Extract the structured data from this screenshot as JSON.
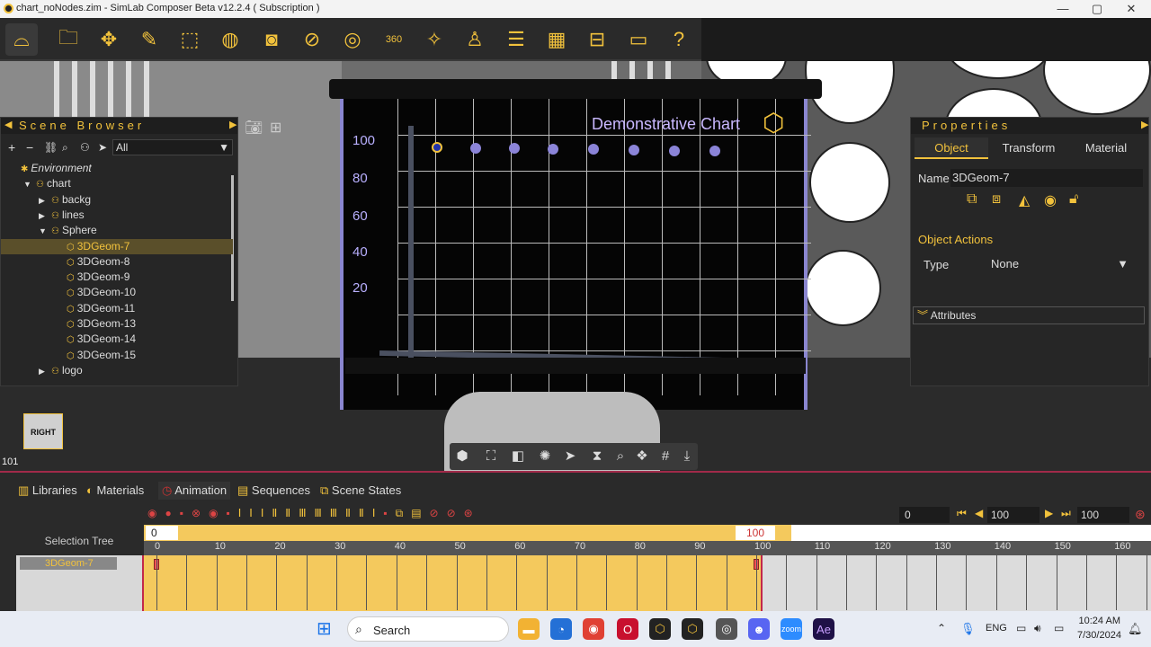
{
  "titlebar": {
    "title": "chart_noNodes.zim - SimLab Composer Beta v12.2.4 ( Subscription )",
    "min": "—",
    "max": "▢",
    "close": "✕"
  },
  "toolbar": {
    "icons": [
      "vr-headset-icon",
      "open-folder-icon",
      "move-icon",
      "edit-icon",
      "select-box-icon",
      "render-icon",
      "camera-icon",
      "material-icon",
      "globe-icon",
      "panorama-360-icon",
      "magic-wand-icon",
      "light-icon",
      "list-icon",
      "grid-icon",
      "vr-view-icon",
      "presentation-icon",
      "help-icon"
    ]
  },
  "chart": {
    "title": "Demonstrative Chart",
    "yticks": [
      "100",
      "80",
      "60",
      "40",
      "20"
    ],
    "chart_data": {
      "type": "scatter",
      "title": "Demonstrative Chart",
      "y": [
        100,
        100,
        100,
        100,
        100,
        100,
        100,
        100
      ],
      "yticks": [
        100,
        80,
        60,
        40,
        20
      ]
    }
  },
  "viewcube": {
    "label": "RIGHT"
  },
  "frame_counter": "101",
  "scene_browser": {
    "title": "Scene Browser",
    "filter": "All",
    "items": [
      {
        "label": "Environment",
        "indent": 0,
        "expander": "",
        "icon": "✱"
      },
      {
        "label": "chart",
        "indent": 1,
        "expander": "▼",
        "icon": "⚇"
      },
      {
        "label": "backg",
        "indent": 2,
        "expander": "▶",
        "icon": "⚇"
      },
      {
        "label": "lines",
        "indent": 2,
        "expander": "▶",
        "icon": "⚇"
      },
      {
        "label": "Sphere",
        "indent": 2,
        "expander": "▼",
        "icon": "⚇"
      },
      {
        "label": "3DGeom-7",
        "indent": 3,
        "expander": "",
        "icon": "⬡"
      },
      {
        "label": "3DGeom-8",
        "indent": 3,
        "expander": "",
        "icon": "⬡"
      },
      {
        "label": "3DGeom-9",
        "indent": 3,
        "expander": "",
        "icon": "⬡"
      },
      {
        "label": "3DGeom-10",
        "indent": 3,
        "expander": "",
        "icon": "⬡"
      },
      {
        "label": "3DGeom-11",
        "indent": 3,
        "expander": "",
        "icon": "⬡"
      },
      {
        "label": "3DGeom-13",
        "indent": 3,
        "expander": "",
        "icon": "⬡"
      },
      {
        "label": "3DGeom-14",
        "indent": 3,
        "expander": "",
        "icon": "⬡"
      },
      {
        "label": "3DGeom-15",
        "indent": 3,
        "expander": "",
        "icon": "⬡"
      },
      {
        "label": "logo",
        "indent": 2,
        "expander": "▶",
        "icon": "⚇"
      }
    ]
  },
  "properties": {
    "title": "Properties",
    "tabs": [
      "Object",
      "Transform",
      "Material"
    ],
    "name_label": "Name",
    "name_value": "3DGeom-7",
    "object_actions": "Object Actions",
    "type_label": "Type",
    "type_value": "None",
    "attributes": "Attributes"
  },
  "bottom": {
    "tabs": [
      "Libraries",
      "Materials",
      "Animation",
      "Sequences",
      "Scene States"
    ],
    "selection_tree": "Selection Tree",
    "track_name": "3DGeom-7",
    "range_start": "0",
    "range_end": "100",
    "current_frame": "0",
    "start_field": "100",
    "end_field": "100",
    "ruler": [
      "0",
      "10",
      "20",
      "30",
      "40",
      "50",
      "60",
      "70",
      "80",
      "90",
      "100",
      "110",
      "120",
      "130",
      "140",
      "150",
      "160"
    ]
  },
  "taskbar": {
    "search": "Search",
    "lang": "ENG",
    "time": "10:24 AM",
    "date": "7/30/2024"
  }
}
